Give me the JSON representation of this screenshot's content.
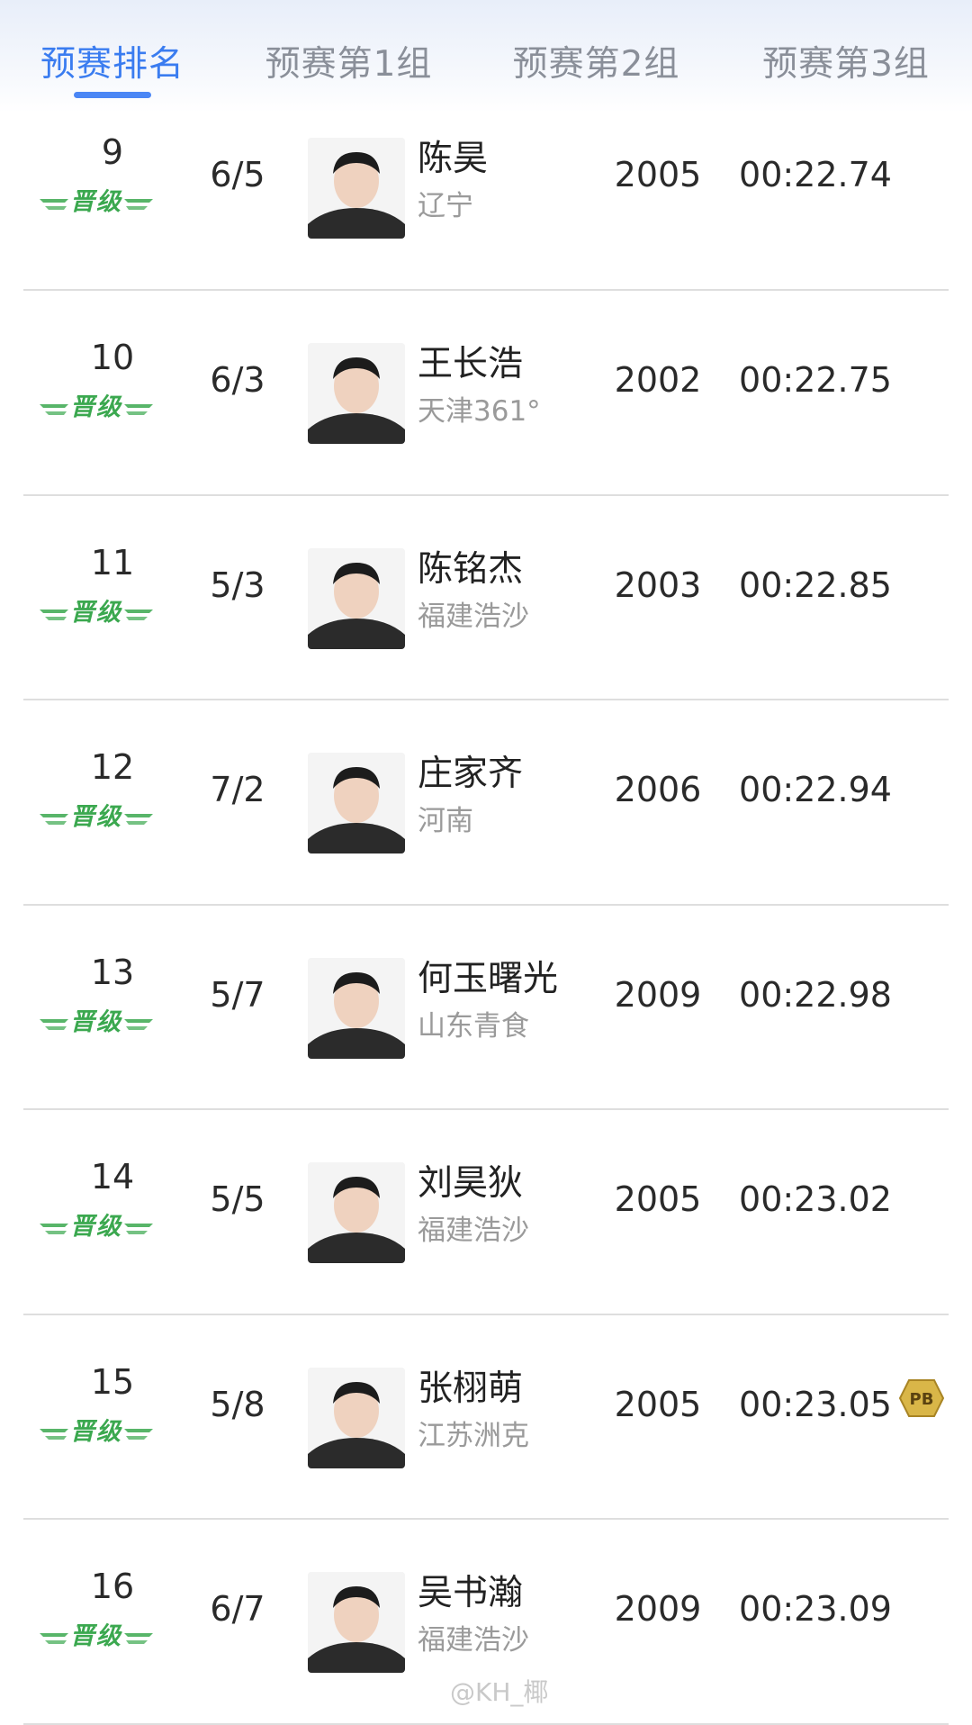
{
  "tabs": [
    {
      "label": "预赛排名",
      "active": true
    },
    {
      "label": "预赛第1组",
      "active": false
    },
    {
      "label": "预赛第2组",
      "active": false
    },
    {
      "label": "预赛第3组",
      "active": false
    }
  ],
  "qualify_label": "晋级",
  "rows": [
    {
      "rank": "9",
      "lane": "6/5",
      "name": "陈昊",
      "team": "辽宁",
      "year": "2005",
      "time": "00:22.74",
      "pb": ""
    },
    {
      "rank": "10",
      "lane": "6/3",
      "name": "王长浩",
      "team": "天津361°",
      "year": "2002",
      "time": "00:22.75",
      "pb": ""
    },
    {
      "rank": "11",
      "lane": "5/3",
      "name": "陈铭杰",
      "team": "福建浩沙",
      "year": "2003",
      "time": "00:22.85",
      "pb": ""
    },
    {
      "rank": "12",
      "lane": "7/2",
      "name": "庄家齐",
      "team": "河南",
      "year": "2006",
      "time": "00:22.94",
      "pb": ""
    },
    {
      "rank": "13",
      "lane": "5/7",
      "name": "何玉曙光",
      "team": "山东青食",
      "year": "2009",
      "time": "00:22.98",
      "pb": ""
    },
    {
      "rank": "14",
      "lane": "5/5",
      "name": "刘昊狄",
      "team": "福建浩沙",
      "year": "2005",
      "time": "00:23.02",
      "pb": ""
    },
    {
      "rank": "15",
      "lane": "5/8",
      "name": "张栩萌",
      "team": "江苏洲克",
      "year": "2005",
      "time": "00:23.05",
      "pb": "PB"
    },
    {
      "rank": "16",
      "lane": "6/7",
      "name": "吴书瀚",
      "team": "福建浩沙",
      "year": "2009",
      "time": "00:23.09",
      "pb": ""
    }
  ],
  "watermark": "@KH_椰",
  "colors": {
    "accent": "#3a7cf0",
    "qualify_green": "#3ba84f",
    "pb_gold": "#c8a23c"
  }
}
